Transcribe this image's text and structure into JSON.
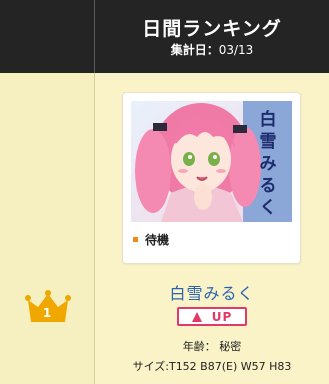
{
  "header": {
    "title": "日間ランキング",
    "subtitle_label": "集計日：",
    "subtitle_date": "03/13"
  },
  "ranking": {
    "rank": "1",
    "crown_color": "#f0a800",
    "icon": "crown-icon"
  },
  "entry": {
    "photo_text": "白雪みるく",
    "status": "待機",
    "name": "白雪みるく",
    "badge": "UP",
    "badge_icon": "up-arrow-icon",
    "age": "年齢：  秘密",
    "size": "サイズ:T152 B87(E) W57 H83"
  },
  "colors": {
    "header_bg": "#242424",
    "page_bg": "#faf3c8",
    "name_color": "#2a64b0",
    "badge_color": "#e03a6a",
    "status_dot": "#f08a1a"
  }
}
